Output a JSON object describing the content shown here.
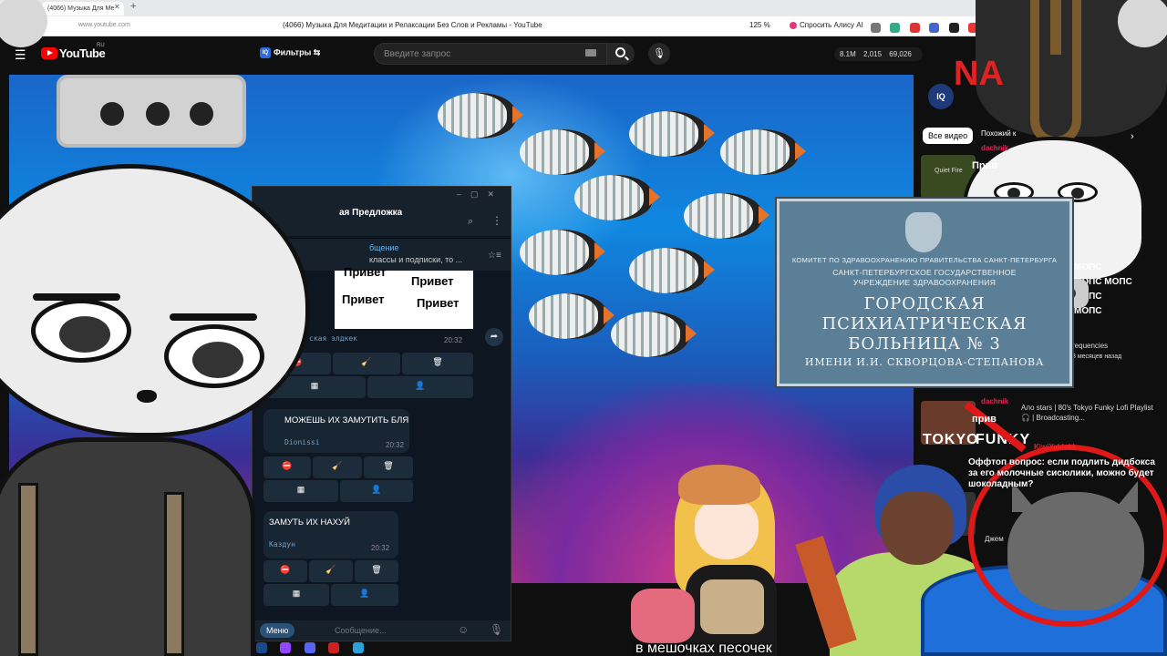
{
  "browser": {
    "tab_title": "(4066) Музыка Для Ме",
    "url": "www.youtube.com",
    "page_title": "(4066) Музыка Для Медитации и Релаксации Без Слов и Рекламы - YouTube",
    "zoom": "125 %",
    "alice_label": "Спросить Алису AI"
  },
  "youtube": {
    "logo_text": "YouTube",
    "region": "RU",
    "filters_label": "Фильтры",
    "iq_badge": "IQ",
    "search_placeholder": "Введите запрос",
    "stats": {
      "views": "8.1M",
      "viewers": "2,015",
      "likes": "69,026"
    },
    "sidebar": {
      "chip_all": "Все видео",
      "chip_similar": "Похожий к",
      "rec1_channel": "Quiet Fire",
      "rec2_meta1": "requencies",
      "rec2_meta2": "8 месяцев назад",
      "rec3_title": "Ало stars | 80's Tokyo Funky Lofi Playlist 🎧 | Broadcasting...",
      "tokyo_label": "TOKYO",
      "funky_label": "FUNKY",
      "mix_label": "Джем"
    }
  },
  "telegram": {
    "chat_title": "ая Предложка",
    "pinned_title": "бщение",
    "pinned_text": "классы и подписки, то ...",
    "sticker_words": [
      "Привет",
      "Привет",
      "Привет",
      "Привет"
    ],
    "msg0_author": "ская элдкек",
    "msg0_time": "20:32",
    "msg1_text": "МОЖЕШЬ ИХ ЗАМУТИТЬ БЛЯ",
    "msg1_author": "Dionissi",
    "msg1_time": "20:32",
    "msg2_text": "ЗАМУТЬ ИХ НАХУЙ",
    "msg2_author": "Каздун",
    "msg2_time": "20:32",
    "menu_label": "Меню",
    "input_placeholder": "Сообщение..."
  },
  "sign": {
    "line1": "КОМИТЕТ ПО ЗДРАВООХРАНЕНИЮ ПРАВИТЕЛЬСТВА САНКТ-ПЕТЕРБУРГА",
    "line2": "САНКТ-ПЕТЕРБУРГСКОЕ ГОСУДАРСТВЕННОЕ",
    "line3": "УЧРЕЖДЕНИЕ ЗДРАВООХРАНЕНИЯ",
    "big1": "ГОРОДСКАЯ",
    "big2": "ПСИХИАТРИЧЕСКАЯ",
    "big3": "БОЛЬНИЦА № 3",
    "name": "ИМЕНИ И.И. СКВОРЦОВА-СТЕПАНОВА"
  },
  "overlay": {
    "na_text": "NA",
    "mops": [
      "МОПС",
      "МОПС МОПС",
      "МОПС",
      "МОПС"
    ],
    "chat1_name": "dachnik",
    "chat1_text": "Прив",
    "chat2_name": "dachnik",
    "chat2_text": "прив",
    "chat3_name": "KiwiYablokk",
    "chat3_text": "Оффтоп вопрос: если подлить дидбокса за его молочные сисюлики, можно будет шоколадным?",
    "subtitle": "в мешочках песочек"
  },
  "colors": {
    "yt_red": "#ff0000",
    "tg_bg": "#0e1621",
    "sign_blue": "#5b7f96",
    "ring_red": "#e01818"
  }
}
